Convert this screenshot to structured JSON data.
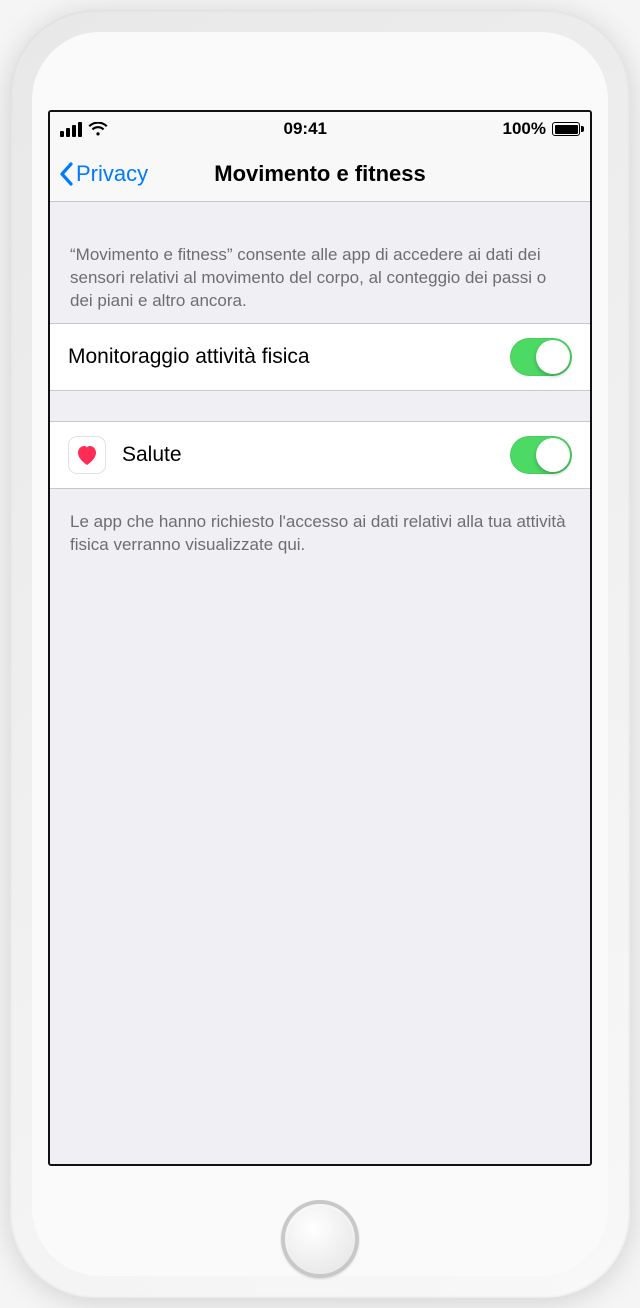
{
  "statusBar": {
    "time": "09:41",
    "batteryText": "100%"
  },
  "nav": {
    "backLabel": "Privacy",
    "title": "Movimento e fitness"
  },
  "sections": {
    "introText": "“Movimento e fitness” consente alle app di accedere ai dati dei sensori relativi al movimento del corpo, al conteggio dei passi o dei piani e altro ancora.",
    "fitnessTracking": {
      "label": "Monitoraggio attività fisica",
      "enabled": true
    },
    "apps": [
      {
        "iconName": "heart-icon",
        "label": "Salute",
        "enabled": true
      }
    ],
    "footerText": "Le app che hanno richiesto l'accesso ai dati relativi alla tua attività fisica verranno visualizzate qui."
  }
}
